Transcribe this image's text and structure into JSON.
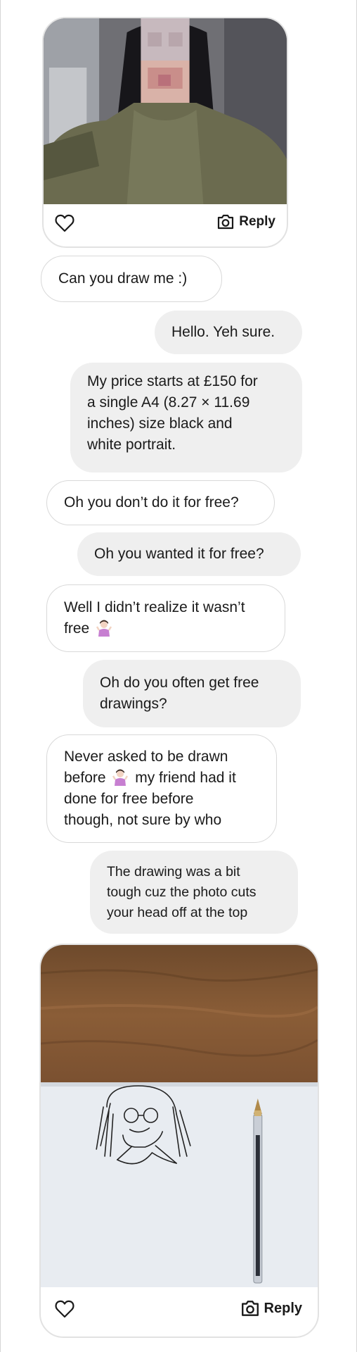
{
  "post1": {
    "reply_label": "Reply",
    "icons": {
      "like": "heart-icon",
      "reply": "camera-icon"
    }
  },
  "messages": [
    {
      "side": "incoming",
      "lines": [
        "Can you draw me :)"
      ]
    },
    {
      "side": "outgoing",
      "lines": [
        "Hello. Yeh sure."
      ]
    },
    {
      "side": "outgoing",
      "lines": [
        "My price starts at £150 for",
        "a single A4 (8.27 × 11.69",
        "inches) size black and",
        "white portrait."
      ]
    },
    {
      "side": "incoming",
      "lines": [
        "Oh you don’t do it for free?"
      ]
    },
    {
      "side": "outgoing",
      "lines": [
        "Oh you wanted it for free?"
      ]
    },
    {
      "side": "incoming",
      "lines": [
        "Well I didn’t realize it wasn’t",
        "free"
      ],
      "emoji": "person-shrugging-emoji"
    },
    {
      "side": "outgoing",
      "lines": [
        "Oh do you often get free",
        "drawings?"
      ]
    },
    {
      "side": "incoming",
      "lines": [
        "Never asked to be drawn",
        "before",
        "my friend had it",
        "done for free before",
        "though, not sure by who"
      ],
      "emoji": "person-shrugging-emoji"
    },
    {
      "side": "outgoing",
      "lines": [
        "The drawing was a bit",
        "tough cuz the photo cuts",
        "your head off at the top"
      ]
    }
  ],
  "post2": {
    "reply_label": "Reply",
    "icons": {
      "like": "heart-icon",
      "reply": "camera-icon"
    }
  },
  "colors": {
    "incoming_bubble": "#ffffff",
    "outgoing_bubble": "#efefef",
    "border": "#d9d9d9"
  }
}
